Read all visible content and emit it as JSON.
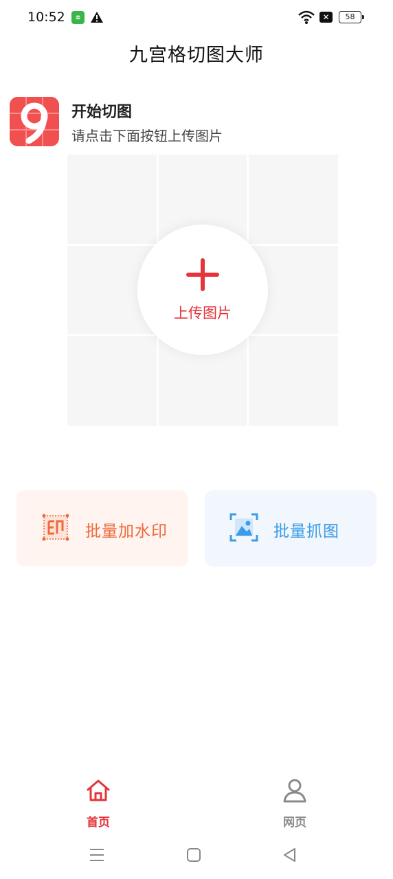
{
  "status_bar": {
    "time": "10:52",
    "battery": "58",
    "icons": [
      "app-notification-icon",
      "warning-icon",
      "wifi-icon",
      "no-sim-icon",
      "battery-icon"
    ]
  },
  "header": {
    "title": "九宫格切图大师"
  },
  "intro": {
    "logo_icon": "nine-grid-logo-icon",
    "title": "开始切图",
    "subtitle": "请点击下面按钮上传图片"
  },
  "upload": {
    "label": "上传图片",
    "icon": "plus-icon",
    "accent": "#e5343a"
  },
  "actions": [
    {
      "label": "批量加水印",
      "icon": "watermark-icon",
      "color": "#ee6a3c",
      "bg": "#fff4f0"
    },
    {
      "label": "批量抓图",
      "icon": "image-capture-icon",
      "color": "#3a9be8",
      "bg": "#f1f7fd"
    }
  ],
  "bottom_nav": [
    {
      "label": "首页",
      "icon": "home-icon",
      "active": true
    },
    {
      "label": "网页",
      "icon": "user-icon",
      "active": false
    }
  ],
  "system_nav": [
    "menu-icon",
    "home-square-icon",
    "back-triangle-icon"
  ]
}
